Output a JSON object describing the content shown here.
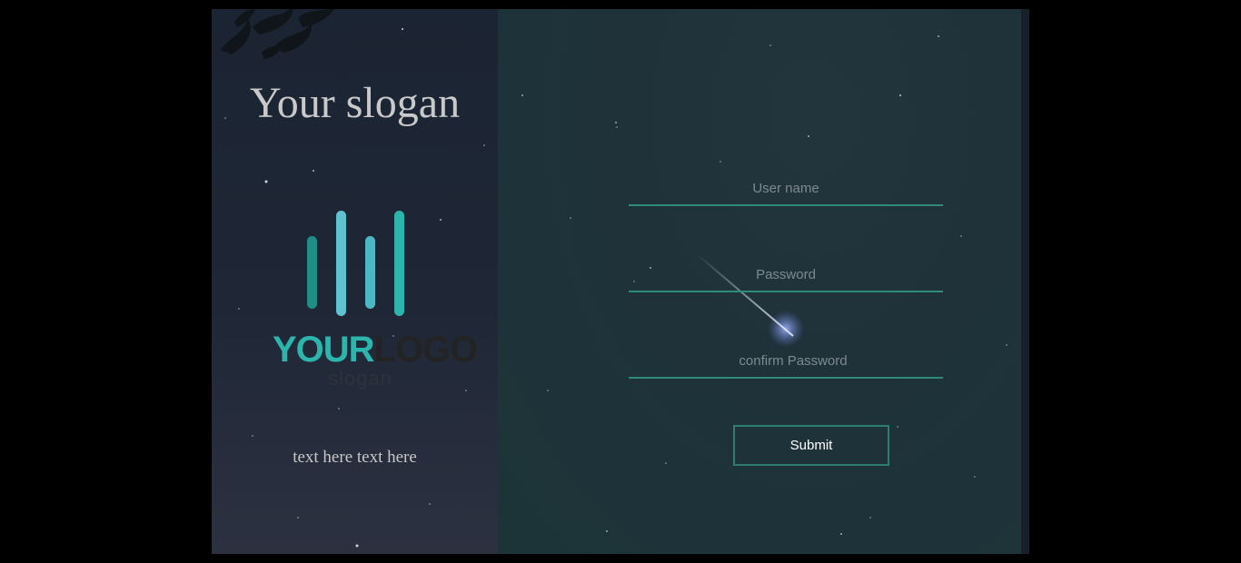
{
  "left_panel": {
    "slogan": "Your slogan",
    "logo": {
      "word1": "YOUR",
      "word2": "LOGO",
      "sub": "slogan",
      "bar_color": "#2bb5ad"
    },
    "text": "text here text here"
  },
  "form": {
    "username": {
      "placeholder": "User name",
      "value": ""
    },
    "password": {
      "placeholder": "Password",
      "value": ""
    },
    "confirm_password": {
      "placeholder": "confirm Password",
      "value": ""
    },
    "submit_label": "Submit"
  },
  "colors": {
    "accent": "#2f8a7c",
    "page_background": "#000000"
  }
}
